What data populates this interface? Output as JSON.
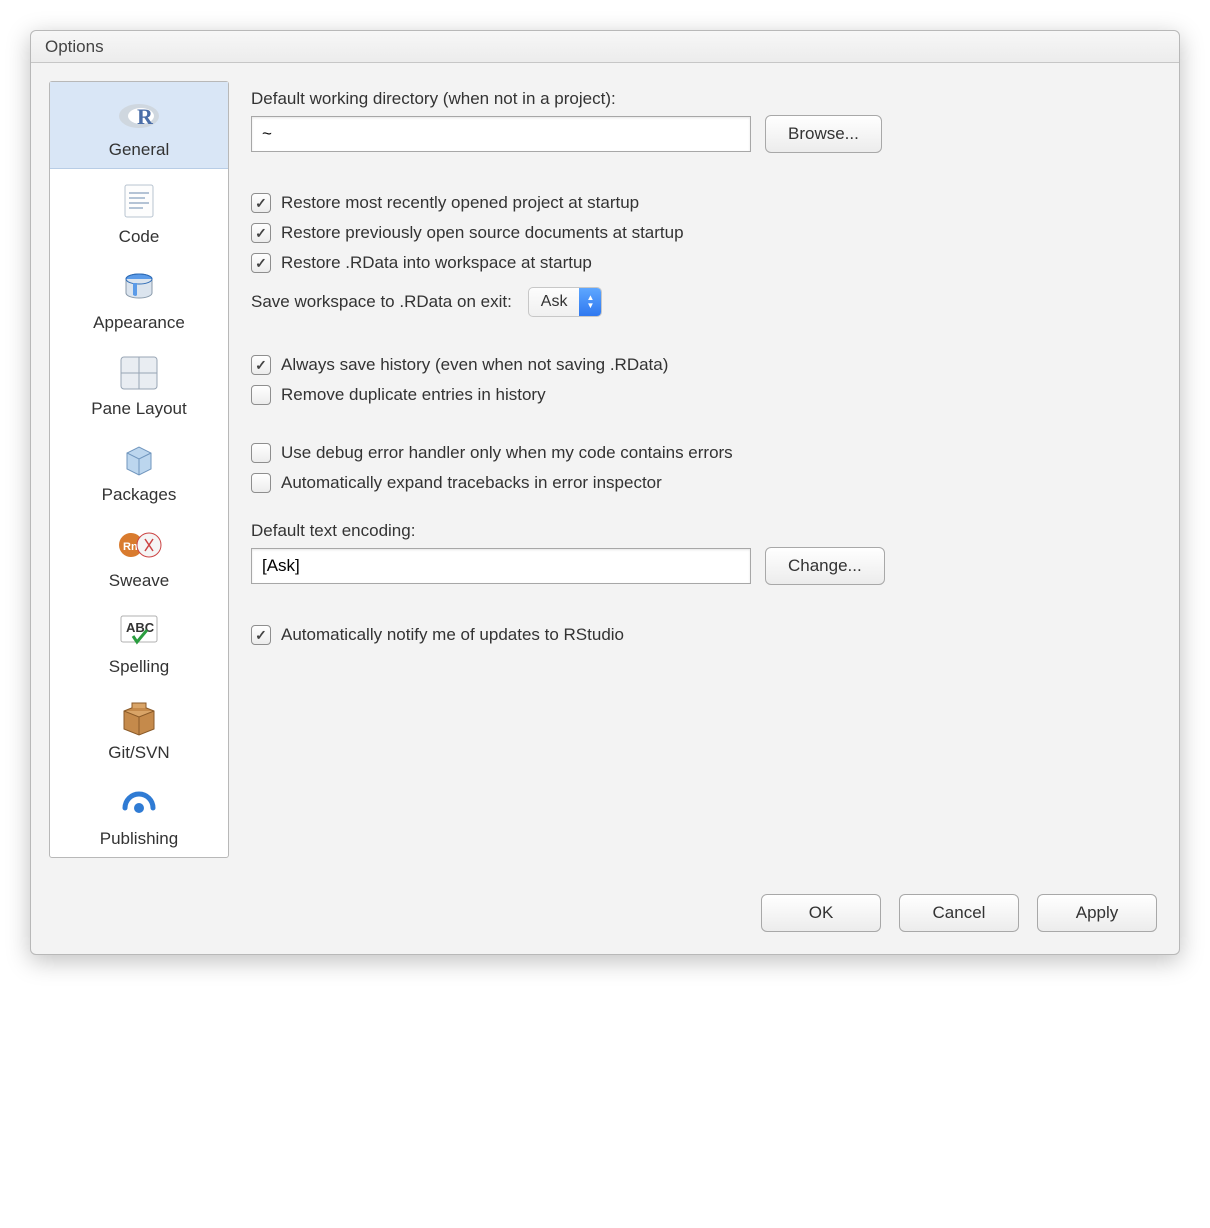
{
  "window": {
    "title": "Options"
  },
  "sidebar": {
    "items": [
      {
        "label": "General"
      },
      {
        "label": "Code"
      },
      {
        "label": "Appearance"
      },
      {
        "label": "Pane Layout"
      },
      {
        "label": "Packages"
      },
      {
        "label": "Sweave"
      },
      {
        "label": "Spelling"
      },
      {
        "label": "Git/SVN"
      },
      {
        "label": "Publishing"
      }
    ]
  },
  "general": {
    "workingDirLabel": "Default working directory (when not in a project):",
    "workingDirValue": "~",
    "browseLabel": "Browse...",
    "restoreProject": "Restore most recently opened project at startup",
    "restoreDocs": "Restore previously open source documents at startup",
    "restoreRData": "Restore .RData into workspace at startup",
    "saveWorkspaceLabel": "Save workspace to .RData on exit:",
    "saveWorkspaceValue": "Ask",
    "alwaysSaveHistory": "Always save history (even when not saving .RData)",
    "removeDupHistory": "Remove duplicate entries in history",
    "debugErrorHandler": "Use debug error handler only when my code contains errors",
    "expandTracebacks": "Automatically expand tracebacks in error inspector",
    "encodingLabel": "Default text encoding:",
    "encodingValue": "[Ask]",
    "changeLabel": "Change...",
    "notifyUpdates": "Automatically notify me of updates to RStudio"
  },
  "footer": {
    "ok": "OK",
    "cancel": "Cancel",
    "apply": "Apply"
  }
}
